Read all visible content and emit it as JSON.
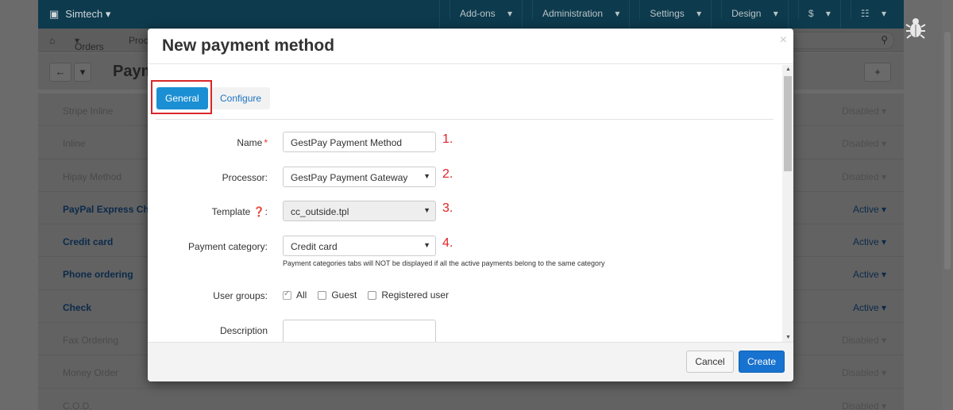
{
  "background": {
    "brand": "Simtech",
    "top_menu": [
      "Add-ons",
      "Administration",
      "Settings",
      "Design",
      "$",
      "☷"
    ],
    "breadcrumb_orders": "Orders",
    "breadcrumb_partial": "Proc",
    "page_title_partial": "Paym",
    "rows": [
      {
        "name": "Stripe Inline",
        "status": "Disabled",
        "active": false
      },
      {
        "name": "Inline",
        "status": "Disabled",
        "active": false
      },
      {
        "name": "Hipay Method",
        "status": "Disabled",
        "active": false
      },
      {
        "name": "PayPal Express Checkout",
        "status": "Active",
        "active": true
      },
      {
        "name": "Credit card",
        "status": "Active",
        "active": true
      },
      {
        "name": "Phone ordering",
        "status": "Active",
        "active": true
      },
      {
        "name": "Check",
        "status": "Active",
        "active": true
      },
      {
        "name": "Fax Ordering",
        "status": "Disabled",
        "active": false
      },
      {
        "name": "Money Order",
        "status": "Disabled",
        "active": false
      },
      {
        "name": "C.O.D.",
        "status": "Disabled",
        "active": false
      }
    ]
  },
  "modal": {
    "title": "New payment method",
    "close": "×",
    "tabs": [
      {
        "label": "General",
        "active": true
      },
      {
        "label": "Configure",
        "active": false
      }
    ],
    "fields": {
      "name": {
        "label": "Name",
        "required_mark": "*",
        "value": "GestPay Payment Method",
        "number": "1."
      },
      "processor": {
        "label": "Processor:",
        "value": "GestPay Payment Gateway",
        "number": "2."
      },
      "template": {
        "label": "Template",
        "help_icon": "?",
        "label_suffix": ":",
        "value": "cc_outside.tpl",
        "number": "3."
      },
      "payment_category": {
        "label": "Payment category:",
        "value": "Credit card",
        "number": "4.",
        "hint": "Payment categories tabs will NOT be displayed if all the active payments belong to the same category"
      },
      "user_groups": {
        "label": "User groups:",
        "options": [
          {
            "label": "All",
            "checked": true
          },
          {
            "label": "Guest",
            "checked": false
          },
          {
            "label": "Registered user",
            "checked": false
          }
        ]
      },
      "description": {
        "label": "Description",
        "value": ""
      }
    },
    "footer": {
      "cancel": "Cancel",
      "create": "Create"
    }
  },
  "colors": {
    "accent": "#1b8fd3",
    "primary_button": "#1872cf",
    "annotation": "#e0242a",
    "nav_bg": "#0d3a4d"
  }
}
